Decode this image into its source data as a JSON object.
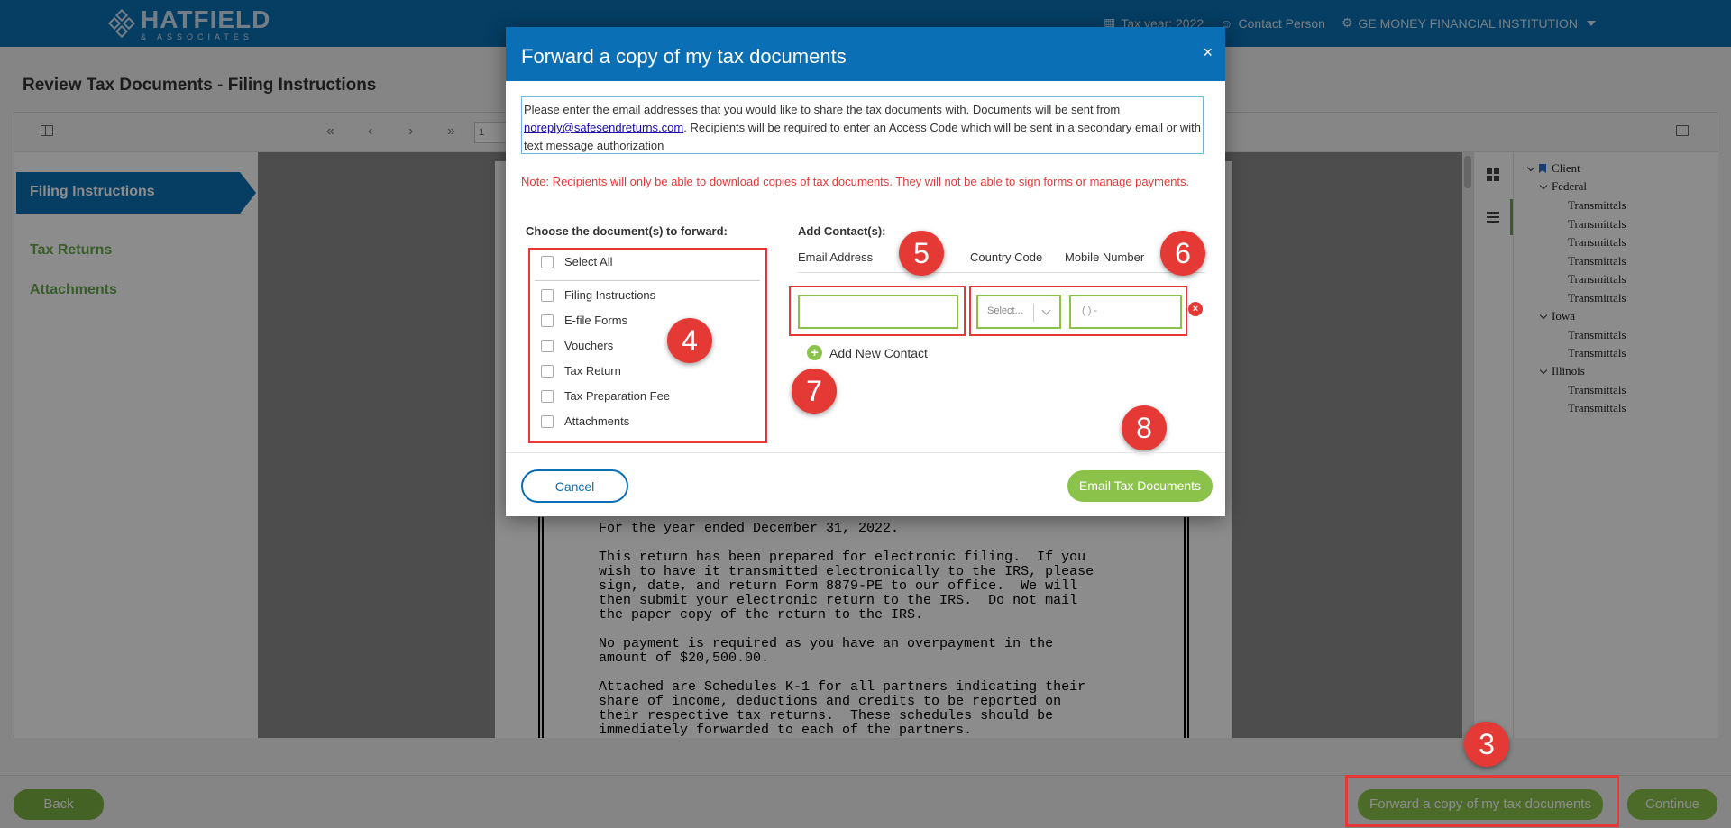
{
  "app": {
    "logo_main": "HATFIELD",
    "logo_sub": "& ASSOCIATES",
    "tax_year": "Tax year: 2022",
    "contact_person": "Contact Person",
    "institution": "GE MONEY FINANCIAL INSTITUTION"
  },
  "page": {
    "title": "Review Tax Documents - Filing Instructions",
    "page_number": "1"
  },
  "leftnav": {
    "active": "Filing Instructions",
    "items": [
      "Tax Returns",
      "Attachments"
    ]
  },
  "document": {
    "text": "For the year ended December 31, 2022.\n\nThis return has been prepared for electronic filing.  If you\nwish to have it transmitted electronically to the IRS, please\nsign, date, and return Form 8879-PE to our office.  We will\nthen submit your electronic return to the IRS.  Do not mail\nthe paper copy of the return to the IRS.\n\nNo payment is required as you have an overpayment in the\namount of $20,500.00.\n\nAttached are Schedules K-1 for all partners indicating their\nshare of income, deductions and credits to be reported on\ntheir respective tax returns.  These schedules should be\nimmediately forwarded to each of the partners."
  },
  "tree": {
    "root": "Client",
    "groups": [
      {
        "name": "Federal",
        "items": [
          "Transmittals",
          "Transmittals",
          "Transmittals",
          "Transmittals",
          "Transmittals",
          "Transmittals"
        ]
      },
      {
        "name": "Iowa",
        "items": [
          "Transmittals",
          "Transmittals"
        ]
      },
      {
        "name": "Illinois",
        "items": [
          "Transmittals",
          "Transmittals"
        ]
      }
    ]
  },
  "footer": {
    "back": "Back",
    "forward": "Forward a copy of my tax documents",
    "continue": "Continue"
  },
  "modal": {
    "title": "Forward a copy of my tax documents",
    "close": "×",
    "info_pre": "Please enter the email addresses that you would like to share the tax documents with. Documents will be sent from ",
    "info_email": "noreply@safesendreturns.com",
    "info_post": ". Recipients will be required to enter an Access Code which will be sent in a secondary email or with text message authorization",
    "note": "Note: Recipients will only be able to download copies of tax documents. They will not be able to sign forms or manage payments.",
    "choose_label": "Choose the document(s) to forward:",
    "select_all": "Select All",
    "documents": [
      "Filing Instructions",
      "E-file Forms",
      "Vouchers",
      "Tax Return",
      "Tax Preparation Fee",
      "Attachments"
    ],
    "add_contacts_label": "Add Contact(s):",
    "col_email": "Email Address",
    "col_country": "Country Code",
    "col_mobile": "Mobile Number",
    "country_placeholder": "Select...",
    "mobile_placeholder": "( ) -",
    "email_value": "",
    "add_new_contact": "Add New Contact",
    "cancel": "Cancel",
    "email_docs": "Email Tax Documents"
  },
  "callouts": [
    "3",
    "4",
    "5",
    "6",
    "7",
    "8"
  ],
  "colors": {
    "brand_blue": "#0a6fb5",
    "green": "#8bc34a",
    "red": "#e53935"
  }
}
